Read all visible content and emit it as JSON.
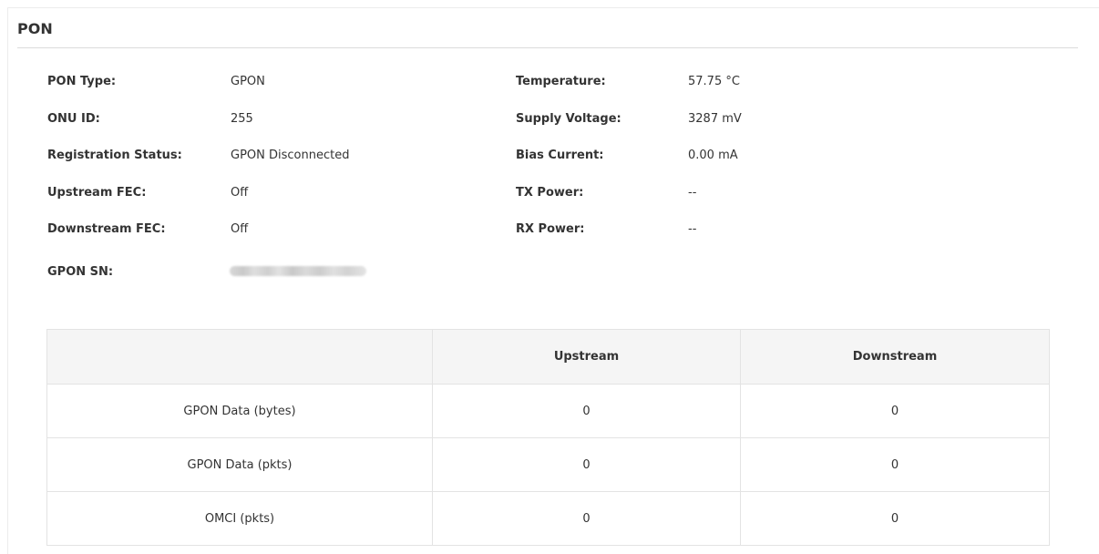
{
  "section": {
    "title": "PON"
  },
  "left_info": [
    {
      "label": "PON Type:",
      "value": "GPON"
    },
    {
      "label": "ONU ID:",
      "value": "255"
    },
    {
      "label": "Registration Status:",
      "value": "GPON Disconnected"
    },
    {
      "label": "Upstream FEC:",
      "value": "Off"
    },
    {
      "label": "Downstream FEC:",
      "value": "Off"
    },
    {
      "label": "GPON SN:",
      "value": ""
    }
  ],
  "right_info": [
    {
      "label": "Temperature:",
      "value": "57.75 °C"
    },
    {
      "label": "Supply Voltage:",
      "value": "3287 mV"
    },
    {
      "label": "Bias Current:",
      "value": "0.00 mA"
    },
    {
      "label": "TX Power:",
      "value": "--"
    },
    {
      "label": "RX Power:",
      "value": "--"
    }
  ],
  "stats_table": {
    "headers": [
      "",
      "Upstream",
      "Downstream"
    ],
    "rows": [
      {
        "label": "GPON Data (bytes)",
        "upstream": "0",
        "downstream": "0"
      },
      {
        "label": "GPON Data (pkts)",
        "upstream": "0",
        "downstream": "0"
      },
      {
        "label": "OMCI (pkts)",
        "upstream": "0",
        "downstream": "0"
      }
    ]
  }
}
